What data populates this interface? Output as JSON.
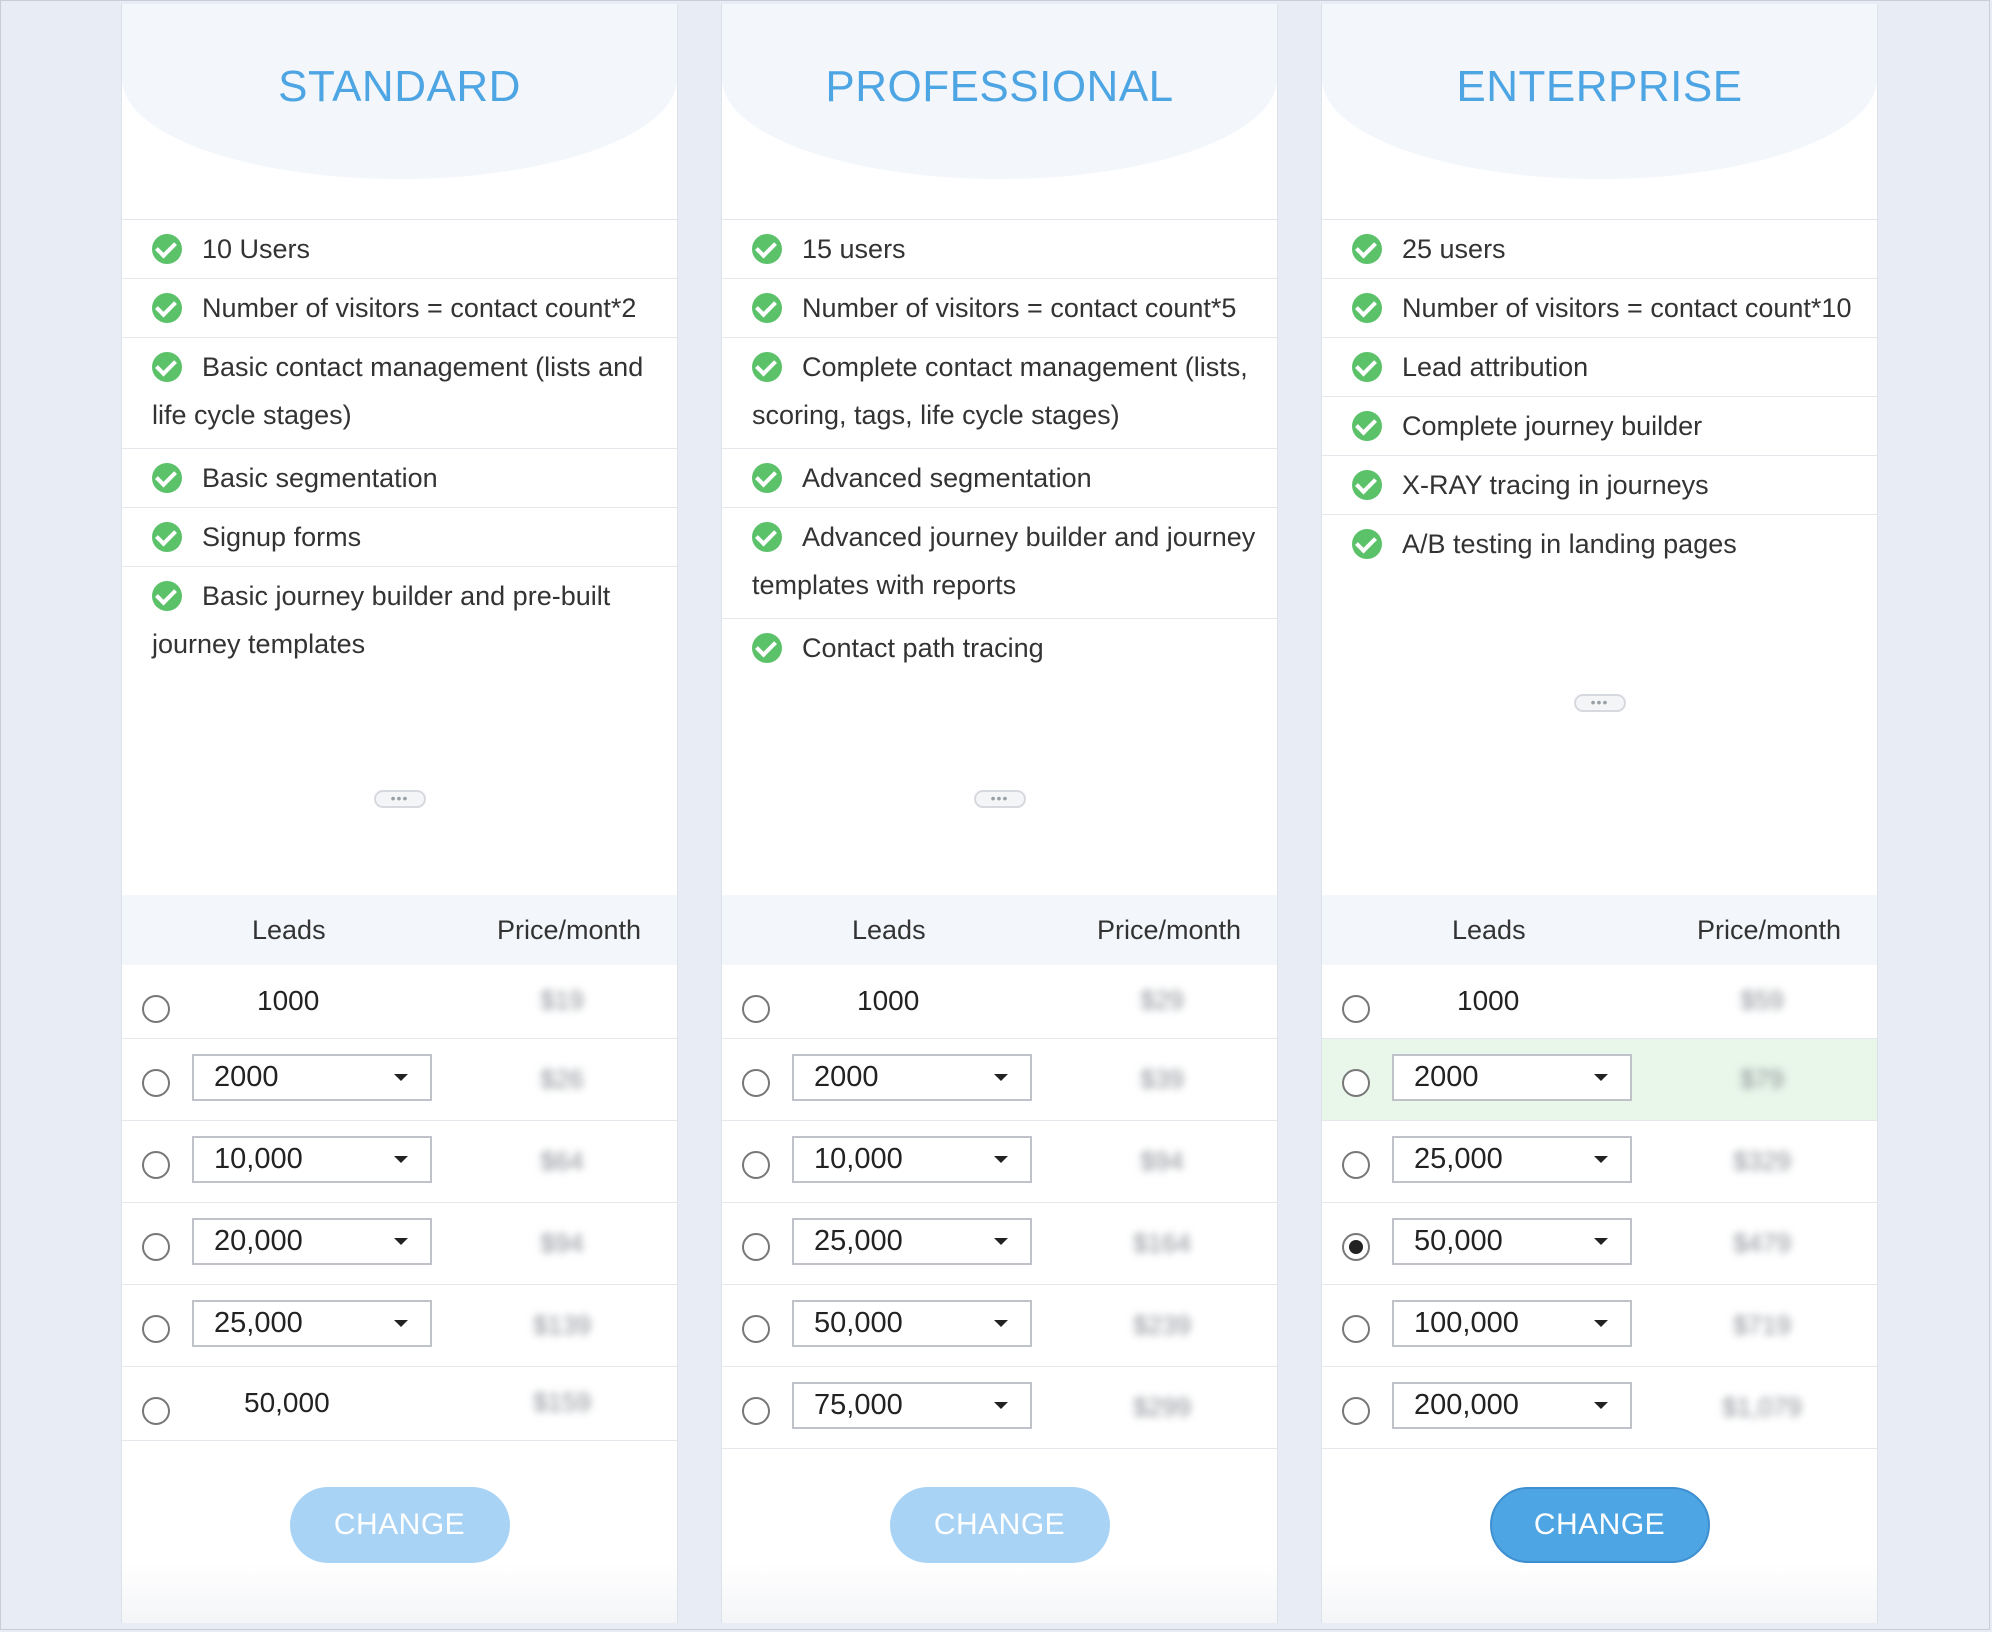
{
  "plans": [
    {
      "title": "STANDARD",
      "features": [
        "10 Users",
        "Number of visitors = contact count*2",
        "Basic contact management (lists and life cycle stages)",
        "Basic segmentation",
        "Signup forms",
        "Basic journey builder and pre-built journey templates"
      ],
      "more_label": "•••",
      "leads_header": "Leads",
      "price_header": "Price/month",
      "tiers": [
        {
          "leads": "1000",
          "price": "$19"
        },
        {
          "leads": "2000",
          "price": "$26"
        },
        {
          "leads": "10,000",
          "price": "$64"
        },
        {
          "leads": "20,000",
          "price": "$94"
        },
        {
          "leads": "25,000",
          "price": "$139"
        },
        {
          "leads": "50,000",
          "price": "$159"
        }
      ],
      "button": "CHANGE"
    },
    {
      "title": "PROFESSIONAL",
      "features": [
        "15 users",
        "Number of visitors = contact count*5",
        "Complete contact management (lists, scoring, tags, life cycle stages)",
        "Advanced segmentation",
        "Advanced journey builder and journey templates with reports",
        "Contact path tracing"
      ],
      "more_label": "•••",
      "leads_header": "Leads",
      "price_header": "Price/month",
      "tiers": [
        {
          "leads": "1000",
          "price": "$29"
        },
        {
          "leads": "2000",
          "price": "$39"
        },
        {
          "leads": "10,000",
          "price": "$94"
        },
        {
          "leads": "25,000",
          "price": "$164"
        },
        {
          "leads": "50,000",
          "price": "$239"
        },
        {
          "leads": "75,000",
          "price": "$299"
        }
      ],
      "button": "CHANGE"
    },
    {
      "title": "ENTERPRISE",
      "features": [
        "25 users",
        "Number of visitors = contact count*10",
        "Lead attribution",
        "Complete journey builder",
        "X-RAY tracing in journeys",
        "A/B testing in landing pages"
      ],
      "more_label": "•••",
      "leads_header": "Leads",
      "price_header": "Price/month",
      "tiers": [
        {
          "leads": "1000",
          "price": "$59"
        },
        {
          "leads": "2000",
          "price": "$79"
        },
        {
          "leads": "25,000",
          "price": "$329"
        },
        {
          "leads": "50,000",
          "price": "$479"
        },
        {
          "leads": "100,000",
          "price": "$719"
        },
        {
          "leads": "200,000",
          "price": "$1,079"
        }
      ],
      "selected_tier": "50,000",
      "button": "CHANGE"
    }
  ],
  "colors": {
    "accent": "#4ea5e3",
    "check": "#5bc26a",
    "button_disabled": "#a9d3f5",
    "highlight_row": "#e8f7ea"
  }
}
